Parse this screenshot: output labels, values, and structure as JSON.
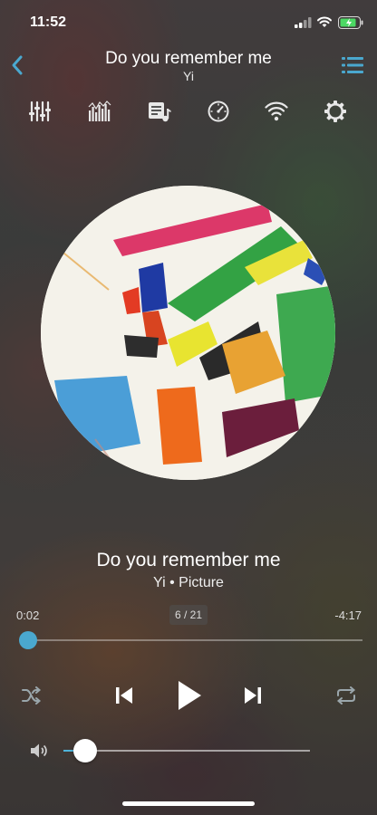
{
  "status_bar": {
    "time": "11:52"
  },
  "header": {
    "title": "Do you remember me",
    "artist": "Yi"
  },
  "toolbar": {
    "items": [
      "equalizer-icon",
      "spectrum-icon",
      "playlist-icon",
      "timer-icon",
      "wifi-transfer-icon",
      "settings-icon"
    ]
  },
  "now_playing": {
    "title": "Do you remember me",
    "subtitle": "Yi • Picture"
  },
  "progress": {
    "elapsed": "0:02",
    "remaining": "-4:17",
    "counter": "6 / 21",
    "fraction": 0.008
  },
  "controls": [
    "shuffle-icon",
    "previous-icon",
    "play-icon",
    "next-icon",
    "repeat-icon"
  ],
  "volume": {
    "level": 0.09
  },
  "colors": {
    "accent": "#4fb3d9",
    "text": "#ffffff"
  }
}
